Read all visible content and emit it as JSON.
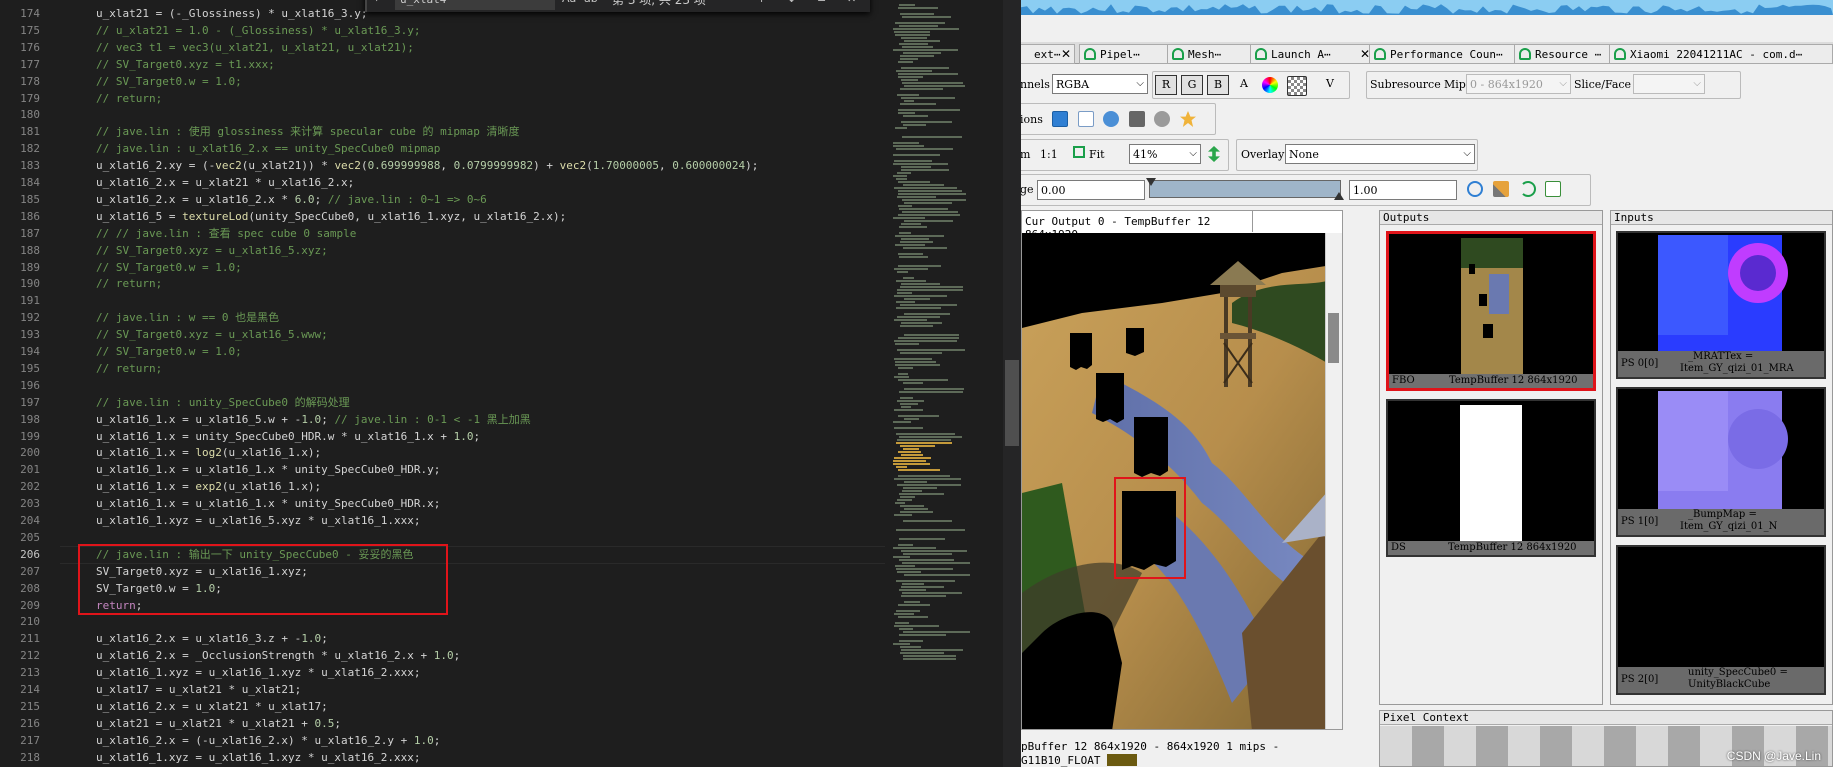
{
  "editor": {
    "find": {
      "query": "u_xlat4",
      "count": "第 3 项, 共 23 项"
    },
    "lines": [
      {
        "n": "174",
        "t": "u_xlat21 = (-_Glossiness) * u_xlat16_3.y;"
      },
      {
        "n": "175",
        "t": "// u_xlat21 = 1.0 - (_Glossiness) * u_xlat16_3.y;"
      },
      {
        "n": "176",
        "t": "// vec3 t1 = vec3(u_xlat21, u_xlat21, u_xlat21);"
      },
      {
        "n": "177",
        "t": "// SV_Target0.xyz = t1.xxx;"
      },
      {
        "n": "178",
        "t": "// SV_Target0.w = 1.0;"
      },
      {
        "n": "179",
        "t": "// return;"
      },
      {
        "n": "180",
        "t": ""
      },
      {
        "n": "181",
        "t": "// jave.lin : 使用 glossiness 来计算 specular cube 的 mipmap 清晰度"
      },
      {
        "n": "182",
        "t": "// jave.lin : u_xlat16_2.x == unity_SpecCube0 mipmap"
      },
      {
        "n": "183",
        "t": "u_xlat16_2.xy = (-vec2(u_xlat21)) * vec2(0.699999988, 0.0799999982) + vec2(1.70000005, 0.600000024);"
      },
      {
        "n": "184",
        "t": "u_xlat16_2.x = u_xlat21 * u_xlat16_2.x;"
      },
      {
        "n": "185",
        "t": "u_xlat16_2.x = u_xlat16_2.x * 6.0; // jave.lin : 0~1 => 0~6"
      },
      {
        "n": "186",
        "t": "u_xlat16_5 = textureLod(unity_SpecCube0, u_xlat16_1.xyz, u_xlat16_2.x);"
      },
      {
        "n": "187",
        "t": "// // jave.lin : 查看 spec cube 0 sample"
      },
      {
        "n": "188",
        "t": "// SV_Target0.xyz = u_xlat16_5.xyz;"
      },
      {
        "n": "189",
        "t": "// SV_Target0.w = 1.0;"
      },
      {
        "n": "190",
        "t": "// return;"
      },
      {
        "n": "191",
        "t": ""
      },
      {
        "n": "192",
        "t": "// jave.lin : w == 0 也是黑色"
      },
      {
        "n": "193",
        "t": "// SV_Target0.xyz = u_xlat16_5.www;"
      },
      {
        "n": "194",
        "t": "// SV_Target0.w = 1.0;"
      },
      {
        "n": "195",
        "t": "// return;"
      },
      {
        "n": "196",
        "t": ""
      },
      {
        "n": "197",
        "t": "// jave.lin : unity_SpecCube0 的解码处理"
      },
      {
        "n": "198",
        "t": "u_xlat16_1.x = u_xlat16_5.w + -1.0; // jave.lin : 0-1 < -1 黑上加黑"
      },
      {
        "n": "199",
        "t": "u_xlat16_1.x = unity_SpecCube0_HDR.w * u_xlat16_1.x + 1.0;"
      },
      {
        "n": "200",
        "t": "u_xlat16_1.x = log2(u_xlat16_1.x);"
      },
      {
        "n": "201",
        "t": "u_xlat16_1.x = u_xlat16_1.x * unity_SpecCube0_HDR.y;"
      },
      {
        "n": "202",
        "t": "u_xlat16_1.x = exp2(u_xlat16_1.x);"
      },
      {
        "n": "203",
        "t": "u_xlat16_1.x = u_xlat16_1.x * unity_SpecCube0_HDR.x;"
      },
      {
        "n": "204",
        "t": "u_xlat16_1.xyz = u_xlat16_5.xyz * u_xlat16_1.xxx;"
      },
      {
        "n": "205",
        "t": ""
      },
      {
        "n": "206",
        "t": "// jave.lin : 输出一下 unity_SpecCube0 - 妥妥的黑色"
      },
      {
        "n": "207",
        "t": "SV_Target0.xyz = u_xlat16_1.xyz;"
      },
      {
        "n": "208",
        "t": "SV_Target0.w = 1.0;"
      },
      {
        "n": "209",
        "t": "return;"
      },
      {
        "n": "210",
        "t": ""
      },
      {
        "n": "211",
        "t": "u_xlat16_2.x = u_xlat16_3.z + -1.0;"
      },
      {
        "n": "212",
        "t": "u_xlat16_2.x = _OcclusionStrength * u_xlat16_2.x + 1.0;"
      },
      {
        "n": "213",
        "t": "u_xlat16_1.xyz = u_xlat16_1.xyz * u_xlat16_2.xxx;"
      },
      {
        "n": "214",
        "t": "u_xlat17 = u_xlat21 * u_xlat21;"
      },
      {
        "n": "215",
        "t": "u_xlat16_2.x = u_xlat21 * u_xlat17;"
      },
      {
        "n": "216",
        "t": "u_xlat21 = u_xlat21 * u_xlat21 + 0.5;"
      },
      {
        "n": "217",
        "t": "u_xlat16_2.x = (-u_xlat16_2.x) * u_xlat16_2.y + 1.0;"
      },
      {
        "n": "218",
        "t": "u_xlat16_1.xyz = u_xlat16_1.xyz * u_xlat16_2.xxx;"
      }
    ]
  },
  "renderdoc": {
    "tabs": [
      "ext⋯",
      "Pipel⋯",
      "Mesh⋯",
      "Launch A⋯",
      "Performance Coun⋯",
      "Resource ⋯",
      "Xiaomi 22041211AC - com.d⋯"
    ],
    "channels_label": "nnels",
    "channels_value": "RGBA",
    "channel_buttons": [
      "R",
      "G",
      "B",
      "A"
    ],
    "v_button": "V",
    "subresource_label": "Subresource",
    "mip_label": "Mip",
    "mip_value": "0 - 864x1920",
    "slice_label": "Slice/Face",
    "actions_label": "ions",
    "zoom_label": "m",
    "zoom_one": "1:1",
    "fit_label": "Fit",
    "zoom_value": "41%",
    "overlay_label": "Overlay",
    "overlay_value": "None",
    "range_label": "ge",
    "range_min": "0.00",
    "range_max": "1.00",
    "viewer_tab": "Cur Output 0 - TempBuffer 12 864x1920",
    "status_line1": "pBuffer 12 864x1920 - 864x1920 1 mips -",
    "status_line2": "G11B10_FLOAT",
    "outputs_title": "Outputs",
    "inputs_title": "Inputs",
    "outputs": [
      {
        "tag": "FBO",
        "name": "TempBuffer 12 864x1920"
      },
      {
        "tag": "DS",
        "name": "TempBuffer 12 864x1920"
      }
    ],
    "inputs": [
      {
        "tag": "PS 0[0]",
        "name1": "_MRATTex =",
        "name2": "Item_GY_qizi_01_MRA"
      },
      {
        "tag": "PS 1[0]",
        "name1": "_BumpMap =",
        "name2": "Item_GY_qizi_01_N"
      },
      {
        "tag": "PS 2[0]",
        "name1": "unity_SpecCube0 =",
        "name2": "UnityBlackCube"
      }
    ],
    "pixel_context_title": "Pixel Context"
  },
  "watermark": "CSDN @Jave.Lin",
  "colors": {
    "highlight": "#e0141a",
    "accent_green": "#1a9f4a"
  }
}
